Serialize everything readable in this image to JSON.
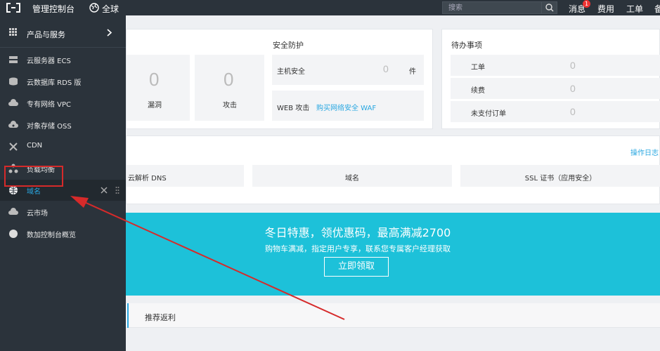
{
  "topbar": {
    "title": "管理控制台",
    "region": "全球",
    "search_placeholder": "搜索",
    "messages": "消息",
    "message_count": "1",
    "fee": "费用",
    "ticket": "工单",
    "cut": "备"
  },
  "sidebar": {
    "header": "产品与服务",
    "items": [
      {
        "label": "云服务器 ECS",
        "icon": "server-icon"
      },
      {
        "label": "云数据库 RDS 版",
        "icon": "database-icon"
      },
      {
        "label": "专有网络 VPC",
        "icon": "cloud-network-icon"
      },
      {
        "label": "对象存储 OSS",
        "icon": "cloud-storage-icon"
      },
      {
        "label": "CDN",
        "icon": "cdn-icon"
      },
      {
        "label": "负载均衡",
        "icon": "load-balancer-icon"
      },
      {
        "label": "域名",
        "icon": "globe-icon"
      },
      {
        "label": "云市场",
        "icon": "market-icon"
      },
      {
        "label": "数加控制台概览",
        "icon": "circle-icon"
      }
    ]
  },
  "security": {
    "vuln_value": "0",
    "vuln_label": "漏洞",
    "attack_value": "0",
    "attack_label": "攻击",
    "title": "安全防护",
    "host_label": "主机安全",
    "host_value": "0",
    "host_unit": "件",
    "web_label": "WEB 攻击",
    "web_link": "购买网络安全 WAF"
  },
  "todo": {
    "title": "待办事项",
    "rows": [
      {
        "label": "工单",
        "value": "0"
      },
      {
        "label": "续费",
        "value": "0"
      },
      {
        "label": "未支付订单",
        "value": "0"
      }
    ]
  },
  "quick": {
    "log_link": "操作日志",
    "dns": "云解析 DNS",
    "domain": "域名",
    "ssl": "SSL 证书（应用安全）"
  },
  "banner": {
    "headline": "冬日特惠，领优惠码，最高满减2700",
    "sub": "购物车满减，指定用户专享，联系您专属客户经理获取",
    "button": "立即领取"
  },
  "tabs": {
    "recommend": "推荐返利"
  },
  "colors": {
    "topbar": "#2b333b",
    "accent": "#29a7e1",
    "banner": "#1dc1d9",
    "highlight": "#d62a2a"
  }
}
